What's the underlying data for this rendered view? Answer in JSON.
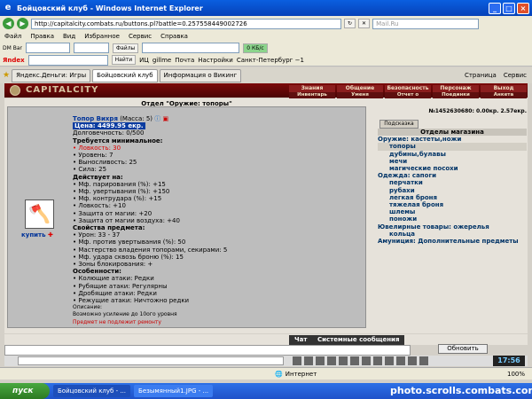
{
  "window": {
    "title": "Бойцовский клуб - Windows Internet Explorer",
    "url": "http://capitalcity.combats.ru/buttons.pl?battle=0.257558449002726",
    "search_placeholder": "Mail.Ru"
  },
  "menu": [
    "Файл",
    "Правка",
    "Вид",
    "Избранное",
    "Сервис",
    "Справка"
  ],
  "toolbar1": {
    "dmbar": "DM Bar",
    "files": "Файлы",
    "kbits": "0 КБ/с"
  },
  "toolbar2": {
    "yandex": "Яndex",
    "find": "Найти",
    "ic": "ИЦ",
    "gillme": "gillme",
    "mail": "Почта",
    "settings": "Настройки",
    "city": "Санкт-Петербург −1"
  },
  "tabs": [
    {
      "label": "Яндекс.Деньги: Игры"
    },
    {
      "label": "Бойцовский клуб"
    },
    {
      "label": "Информация о Викинг"
    }
  ],
  "tab_tools": {
    "page": "Страница",
    "service": "Сервис"
  },
  "game": {
    "logo": "CAPITALCITY",
    "nav_top": [
      "Знания",
      "Общение",
      "Безопасность",
      "Персонаж",
      "Выход"
    ],
    "nav_bottom": [
      "Инвентарь",
      "Уменя",
      "Отчет о переводах",
      "Поединки",
      "Анкета"
    ]
  },
  "shop": {
    "section_title": "Отдел \"Оружие: топоры\"",
    "balance": "№1452630680: 0.00кр. 2.57екр.",
    "hint": "Подсказка",
    "buy": "купить",
    "item": {
      "name": "Топор Вихря",
      "mass": "(Масса: 5)",
      "price": "Цена: 4499.95 екр.",
      "durability": "Долговечность: 0/500",
      "req_title": "Требуется минимальное:",
      "req": [
        "Ловкость: 30",
        "Уровень: 7",
        "Выносливость: 25",
        "Сила: 25"
      ],
      "acts_title": "Действует на:",
      "acts": [
        "Мф. парирования (%): +15",
        "Мф. увертывания (%): +150",
        "Мф. контрудара (%): +15",
        "Ловкость: +10",
        "Защита от магии: +20",
        "Защита от магии воздуха: +40"
      ],
      "props_title": "Свойства предмета:",
      "props": [
        "Урон: 33 - 37",
        "Мф. против увертывания (%): 50",
        "Мастерство владения топорами, секирами: 5",
        "Мф. удара сквозь броню (%): 15",
        "Зоны блокирования: +"
      ],
      "feat_title": "Особенности:",
      "feats": [
        "Колющие атаки: Редки",
        "Рубящие атаки: Регулярны",
        "Дробящие атаки: Редки",
        "Режущие атаки: Ничтожно редки"
      ],
      "desc_title": "Описание:",
      "desc": "Возможно усиление до 10ого уровня",
      "note": "Предмет не подлежит ремонту"
    },
    "depts_title": "Отделы магазина",
    "depts": [
      {
        "cat": "Оружие: кастеты,ножи",
        "subs": [
          "топоры",
          "дубины,булавы",
          "мечи",
          "магические посохи"
        ]
      },
      {
        "cat": "Одежда: сапоги",
        "subs": [
          "перчатки",
          "рубахи",
          "легкая броня",
          "тяжелая броня",
          "шлемы",
          "поножи"
        ]
      },
      {
        "cat": "Ювелирные товары: ожерелья",
        "subs": [
          "кольца"
        ]
      },
      {
        "cat": "Амуниция: Дополнительные предметы",
        "subs": []
      }
    ]
  },
  "chat": {
    "tab_chat": "Чат",
    "tab_system": "Системные сообщения",
    "refresh": "Обновить",
    "time": "17:56"
  },
  "status": {
    "zone": "Интернет",
    "zoom": "100%"
  },
  "taskbar": {
    "start": "пуск",
    "tasks": [
      "Бойцовский клуб - ...",
      "Безымянный1.JPG - ..."
    ],
    "watermark": "photo.scrolls.combats.com"
  }
}
